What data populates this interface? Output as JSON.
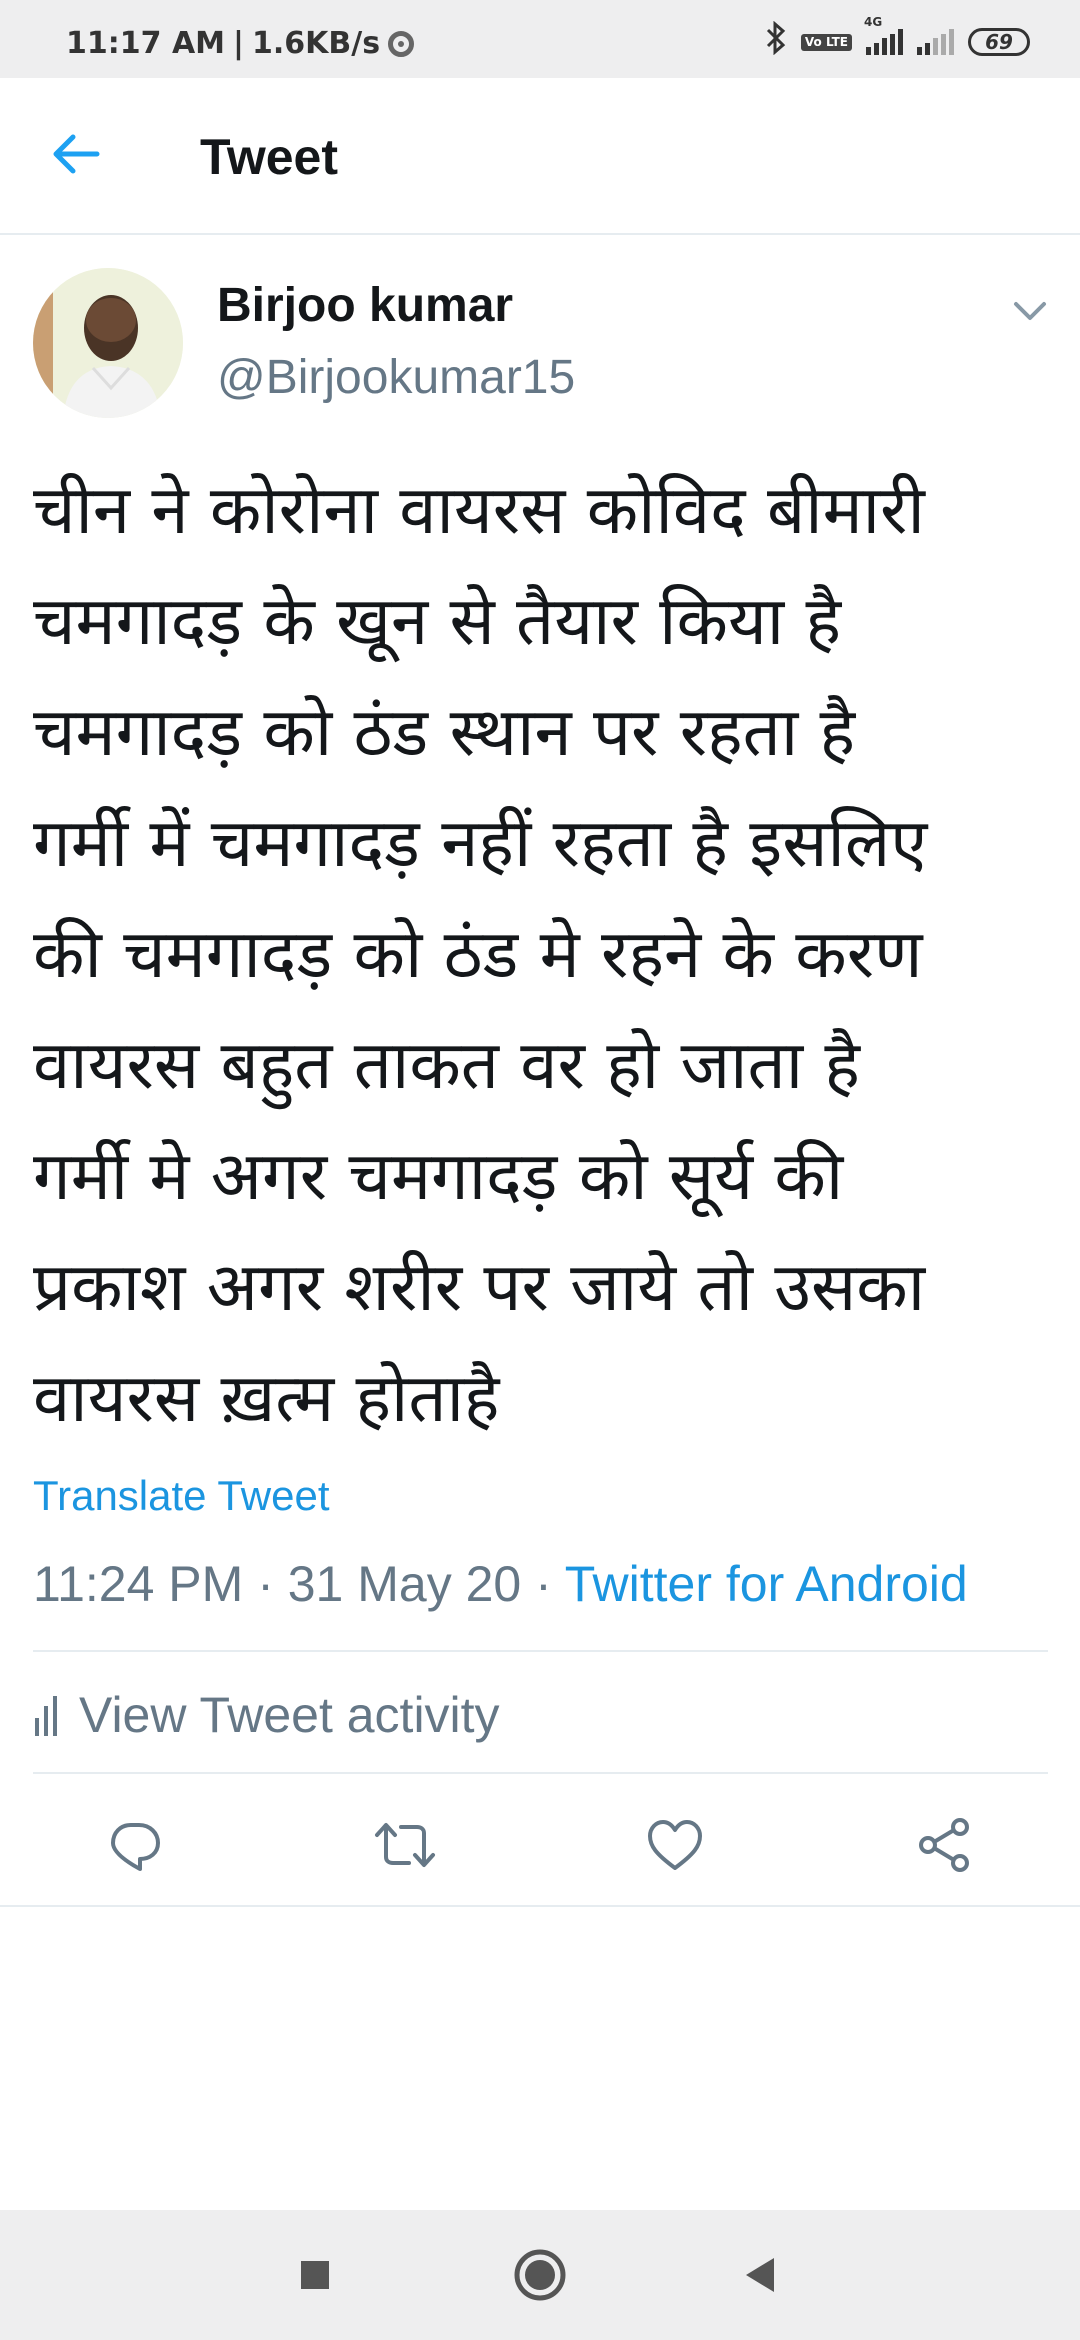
{
  "status_bar": {
    "time": "11:17 AM",
    "net_speed": "1.6KB/s",
    "network_type": "4G",
    "volte": "Vo LTE",
    "battery": "69"
  },
  "header": {
    "title": "Tweet"
  },
  "tweet": {
    "author_name": "Birjoo kumar",
    "author_handle": "@Birjookumar15",
    "text_lines": [
      "चीन ने कोरोना वायरस कोविद बीमारी",
      "चमगादड़ के खून से तैयार किया है",
      "चमगादड़ को ठंड स्थान पर रहता है",
      "गर्मी में चमगादड़ नहीं रहता है इसलिए",
      "की चमगादड़ को ठंड मे रहने के करण",
      "वायरस बहुत ताकत वर हो जाता है",
      "गर्मी मे अगर चमगादड़ को सूर्य की",
      "प्रकाश अगर शरीर पर जाये तो उसका",
      "वायरस ख़त्म होताहै"
    ],
    "translate_label": "Translate Tweet",
    "time": "11:24 PM",
    "separator": " · ",
    "date": "31 May 20",
    "source": "Twitter for Android",
    "activity_label": "View Tweet activity"
  },
  "colors": {
    "accent": "#1b95e0",
    "secondary_text": "#657786",
    "divider": "#e6ecf0"
  },
  "icons": {
    "back": "arrow-left-icon",
    "reply": "reply-icon",
    "retweet": "retweet-icon",
    "like": "heart-icon",
    "share": "share-icon"
  }
}
